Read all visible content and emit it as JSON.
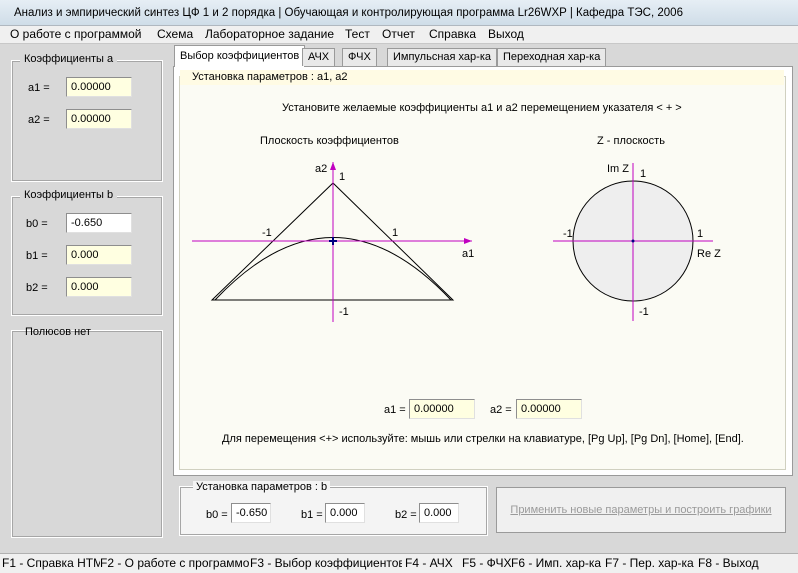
{
  "window": {
    "title": "Анализ и эмпирический синтез ЦФ 1 и 2 порядка | Обучающая и контролирующая программа Lr26WXP | Кафедра ТЭС, 2006"
  },
  "menu": [
    "О работе с программой",
    "Схема",
    "Лабораторное задание",
    "Тест",
    "Отчет",
    "Справка",
    "Выход"
  ],
  "left": {
    "coef_a": {
      "title": "Коэффициенты  a",
      "a1_label": "a1 =",
      "a1": "0.00000",
      "a2_label": "a2 =",
      "a2": "0.00000"
    },
    "coef_b": {
      "title": "Коэффициенты  b",
      "b0_label": "b0 =",
      "b0": "-0.650",
      "b1_label": "b1 =",
      "b1": "0.000",
      "b2_label": "b2 =",
      "b2": "0.000"
    },
    "poles": {
      "title": "Полюсов нет"
    }
  },
  "tabs": [
    "Выбор коэффициентов",
    "АЧХ",
    "ФЧХ",
    "Импульсная хар-ка",
    "Переходная хар-ка"
  ],
  "panel": {
    "heading": "Установка параметров :   a1, a2",
    "instruction": "Установите желаемые коэффициенты a1 и a2 перемещением указателя < + >",
    "coef_plane": {
      "title": "Плоскость коэффициентов",
      "y_axis": "a2",
      "x_axis": "a1",
      "top_tick": "1",
      "left_tick": "-1",
      "right_tick": "1",
      "bottom_tick": "-1"
    },
    "z_plane": {
      "title": "Z - плоскость",
      "im_label": "Im Z",
      "re_label": "Re Z",
      "top_tick": "1",
      "left_tick": "-1",
      "right_tick": "1",
      "bottom_tick": "-1"
    },
    "a1_label": "a1 =",
    "a1": "0.00000",
    "a2_label": "a2 =",
    "a2": "0.00000",
    "hint": "Для перемещения <+> используйте: мышь или стрелки на клавиатуре, [Pg Up], [Pg Dn], [Home], [End]."
  },
  "b_params": {
    "title": "Установка параметров :   b",
    "b0_label": "b0 =",
    "b0": "-0.650",
    "b1_label": "b1 =",
    "b1": "0.000",
    "b2_label": "b2 =",
    "b2": "0.000"
  },
  "apply_button": "Применить новые параметры и построить графики",
  "status": [
    "F1 - Справка HTML",
    "F2 - О работе с программой",
    "F3 - Выбор коэффициентов",
    "F4 - АЧХ",
    "F5 - ФЧХ",
    "F6 - Имп. хар-ка",
    "F7 - Пер. хар-ка",
    "F8 - Выход"
  ]
}
